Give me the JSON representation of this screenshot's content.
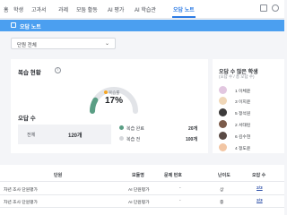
{
  "nav": {
    "items": [
      "홈",
      "학생",
      "고과서",
      "과제",
      "모둠 활동",
      "AI 평가",
      "AI 학습관",
      "오답 노트"
    ],
    "active_index": 7
  },
  "breadcrumb": {
    "label": "오답 노트"
  },
  "unit_select": {
    "value": "단원 전체",
    "chevron": "⌄"
  },
  "review": {
    "title": "복습 현황",
    "info_icon": "i",
    "gauge": {
      "label": "복습률",
      "value": "17%",
      "fraction": 0.17,
      "color": "#5a9e84",
      "track_color": "#e2e4e8"
    },
    "wrong_title": "오답 수",
    "total_label": "전체",
    "total_value": "120개",
    "legend": [
      {
        "label": "복습 완료",
        "value": "20개",
        "color": "#5a9e84"
      },
      {
        "label": "복습 전",
        "value": "100개",
        "color": "#d6d8dc"
      }
    ]
  },
  "ranking": {
    "title": "오답 수 많은 학생",
    "subtitle": "(오답 수 / 총 오답 수)",
    "items": [
      {
        "label": "1 이체윤",
        "color": "#e2c7e0"
      },
      {
        "label": "3 이지윤",
        "color": "#f0d7b8"
      },
      {
        "label": "5 정석원",
        "color": "#3d3b3b"
      },
      {
        "label": "2 서태린",
        "color": "#7b5b4a"
      },
      {
        "label": "6 김수현",
        "color": "#5a4a45"
      },
      {
        "label": "4 정도윤",
        "color": "#f2c6a4"
      }
    ]
  },
  "table": {
    "headers": [
      "단원",
      "모듈명",
      "문제 번호",
      "난이도",
      "오답 수"
    ],
    "rows": [
      {
        "unit": "차년 조사 단원평가",
        "module": "AI 단원평가",
        "number": "-",
        "level": "상",
        "wrong": "2/3"
      },
      {
        "unit": "차년 조사 단원평가",
        "module": "AI 단원평가",
        "number": "-",
        "level": "중",
        "wrong": "2/3"
      }
    ]
  },
  "colors": {
    "accent": "#2c7be5",
    "breadcrumb_bg": "#4b9ff0"
  }
}
